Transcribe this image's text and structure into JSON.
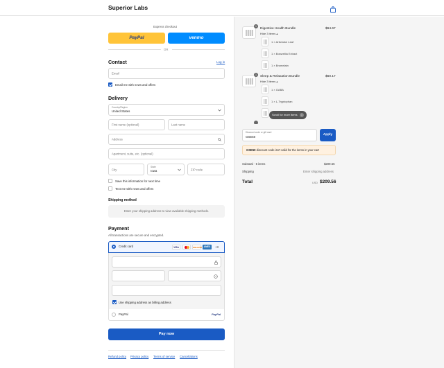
{
  "header": {
    "brand": "Superior Labs",
    "cart_icon": "shopping-bag-icon"
  },
  "express": {
    "label": "Express checkout",
    "paypal": "PayPal",
    "venmo": "venmo",
    "or": "OR"
  },
  "contact": {
    "title": "Contact",
    "login": "Log in",
    "email_placeholder": "Email",
    "news_label": "Email me with news and offers"
  },
  "delivery": {
    "title": "Delivery",
    "country_label": "Country/Region",
    "country_value": "United States",
    "first_name": "First name (optional)",
    "last_name": "Last name",
    "address": "Address",
    "apartment": "Apartment, suite, etc. (optional)",
    "city": "City",
    "state_label": "State",
    "state_value": "Iowa",
    "zip": "ZIP code",
    "save_info": "Save this information for next time",
    "text_me": "Text me with news and offers"
  },
  "shipping": {
    "title": "Shipping method",
    "message": "Enter your shipping address to view available shipping methods."
  },
  "payment": {
    "title": "Payment",
    "subtitle": "All transactions are secure and encrypted.",
    "credit_card": "Credit card",
    "more_cards": "+3",
    "billing_label": "Use shipping address as billing address",
    "paypal_option": "PayPal",
    "paypal_logo": "PayPal",
    "cards": [
      "VISA",
      "MC",
      "DISCOVER",
      "AMEX"
    ]
  },
  "pay_now": "Pay now",
  "footer": {
    "links": [
      "Refund policy",
      "Privacy policy",
      "Terms of service",
      "Cancellations"
    ]
  },
  "summary": {
    "items": [
      {
        "qty": "1",
        "name": "Digestive Health Bundle",
        "price": "$64.67",
        "toggle": "Hide 3 items",
        "sub": [
          "1 × Artichoke Leaf",
          "1 × Boswellia Extract",
          "1 × Bromelain"
        ]
      },
      {
        "qty": "1",
        "name": "Sleep & Relaxation Bundle",
        "price": "$60.17",
        "toggle": "Hide 3 items",
        "sub": [
          "1 × GABA",
          "1 × L-Tryptophan"
        ]
      }
    ],
    "scroll_hint": "Scroll for more items",
    "discount": {
      "label": "Discount code or gift card",
      "value": "GSE50",
      "apply": "Apply",
      "error_code": "GSE50",
      "error_msg": " discount code isn't valid for the items in your cart"
    },
    "subtotal_label": "Subtotal · 5 items",
    "subtotal_value": "$209.56",
    "shipping_label": "Shipping",
    "shipping_value": "Enter shipping address",
    "total_label": "Total",
    "currency": "USD",
    "total_value": "$209.56"
  }
}
